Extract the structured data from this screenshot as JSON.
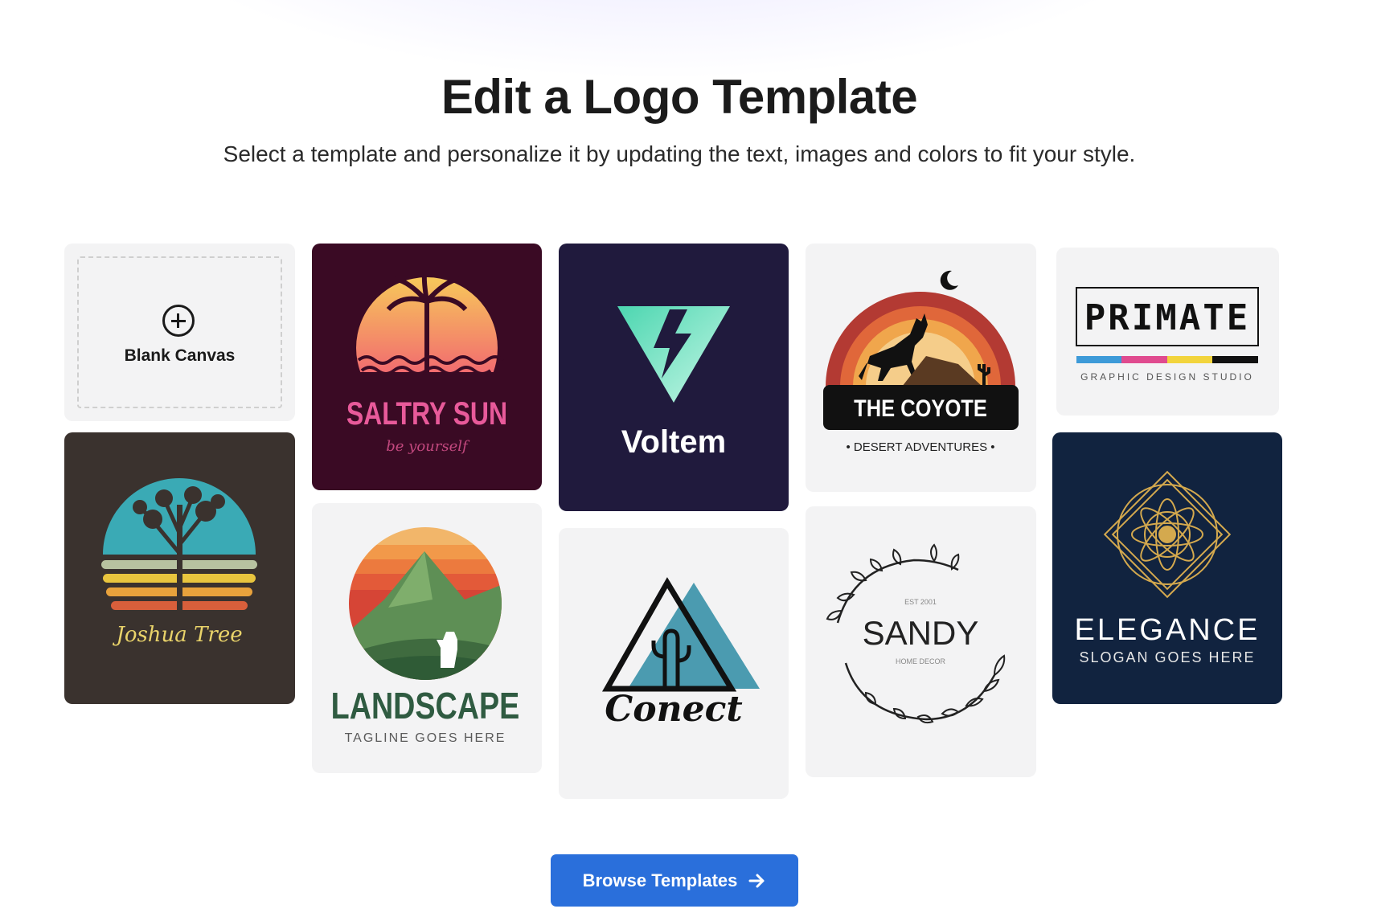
{
  "header": {
    "title": "Edit a Logo Template",
    "subtitle": "Select a template and personalize it by updating the text, images and colors to fit your style."
  },
  "templates": {
    "blank": {
      "label": "Blank Canvas",
      "icon": "plus-circle-icon"
    },
    "saltry_sun": {
      "name": "SALTRY SUN",
      "tagline": "be yourself",
      "bg": "#3a0a24",
      "accent": "#f7964b"
    },
    "voltem": {
      "name": "Voltem",
      "bg": "#201a3d",
      "accent": "#5ee3b8"
    },
    "coyote": {
      "name": "THE COYOTE",
      "tagline": "• DESERT ADVENTURES •",
      "accent": "#b33a33"
    },
    "primate": {
      "name": "PRIMATE",
      "tagline": "GRAPHIC DESIGN STUDIO"
    },
    "joshua_tree": {
      "name": "Joshua Tree",
      "bg": "#3a322e",
      "accent": "#3aaab5"
    },
    "landscape": {
      "name": "LANDSCAPE",
      "tagline": "TAGLINE GOES HERE",
      "accent": "#2f5b41"
    },
    "conect": {
      "name": "Conect",
      "accent": "#4b9bb0"
    },
    "sandy": {
      "name": "SANDY",
      "est": "EST 2001",
      "tagline": "HOME DECOR"
    },
    "elegance": {
      "name": "ELEGANCE",
      "tagline": "SLOGAN GOES HERE",
      "bg": "#11233f",
      "accent": "#d4a94e"
    }
  },
  "cta": {
    "label": "Browse Templates",
    "icon": "arrow-right-icon",
    "color": "#2a6fdb"
  }
}
